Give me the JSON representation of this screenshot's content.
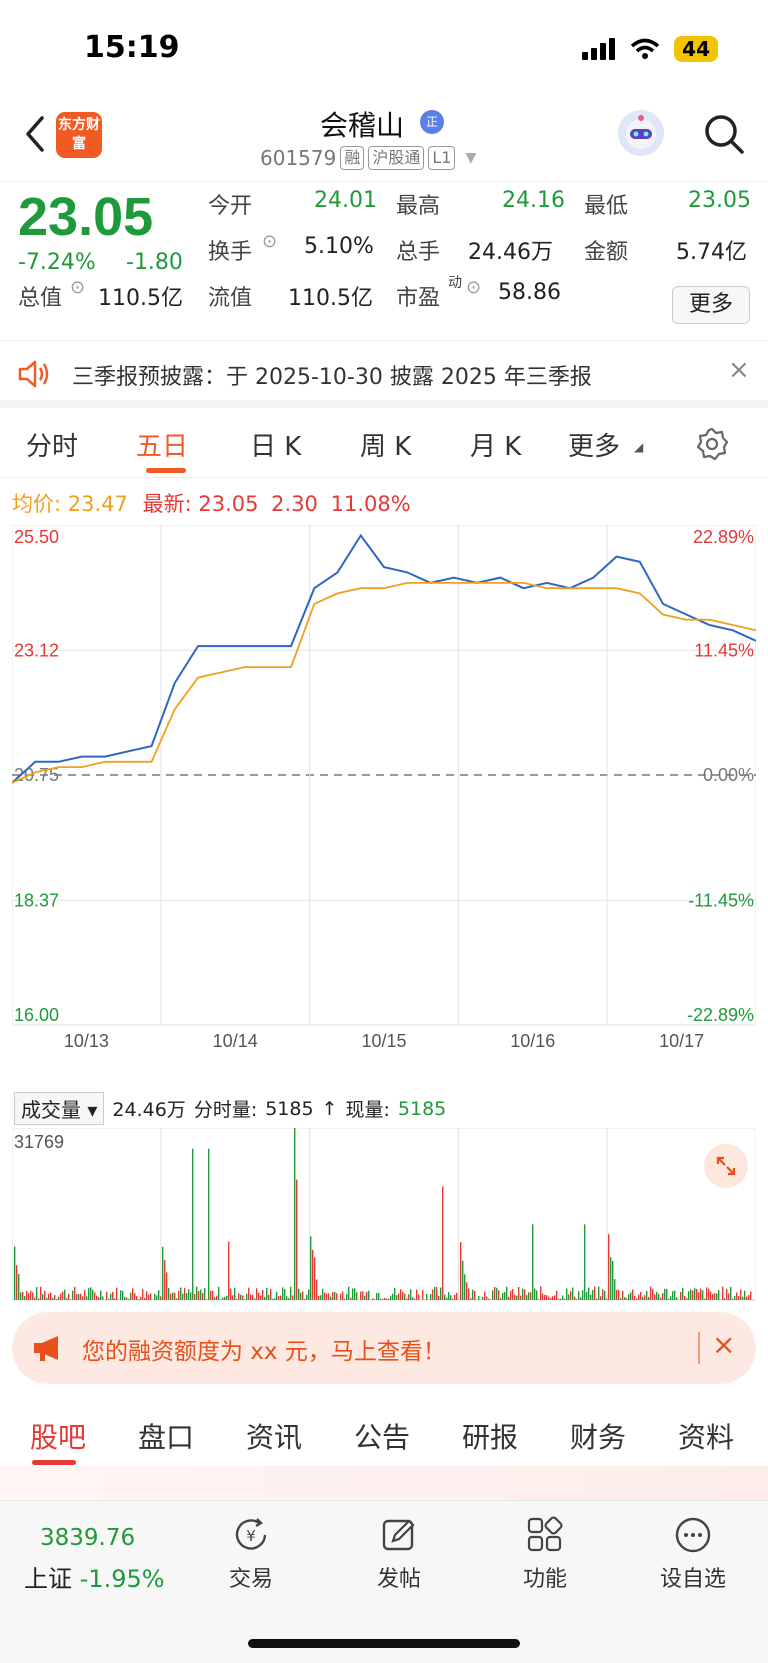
{
  "status_bar": {
    "time": "15:19",
    "battery": "44"
  },
  "header": {
    "app_logo_text": "东方财富",
    "stock_name": "会稽山",
    "badge": "正",
    "code": "601579",
    "tags": [
      "融",
      "沪股通",
      "L1"
    ]
  },
  "quote": {
    "price": "23.05",
    "change_pct": "-7.24%",
    "change": "-1.80",
    "fields": [
      {
        "label": "今开",
        "value": "24.01"
      },
      {
        "label": "最高",
        "value": "24.16"
      },
      {
        "label": "最低",
        "value": "23.05"
      },
      {
        "label": "换手",
        "value": "5.10%"
      },
      {
        "label": "总手",
        "value": "24.46万"
      },
      {
        "label": "金额",
        "value": "5.74亿"
      },
      {
        "label": "总值",
        "value": "110.5亿"
      },
      {
        "label": "流值",
        "value": "110.5亿"
      },
      {
        "label": "市盈",
        "sup": "动",
        "value": "58.86"
      }
    ],
    "more_label": "更多"
  },
  "notice": {
    "text": "三季报预披露：于 2025-10-30 披露 2025 年三季报",
    "close": "×"
  },
  "chart_tabs": {
    "items": [
      "分时",
      "五日",
      "日 K",
      "周 K",
      "月 K",
      "更多"
    ],
    "active": "五日"
  },
  "summary": {
    "avg_label": "均价:",
    "avg_value": "23.47",
    "latest_label": "最新:",
    "latest_value": "23.05",
    "latest_change": "2.30",
    "latest_pct": "11.08%"
  },
  "chart_data": {
    "type": "line",
    "x": [
      "10/13",
      "10/14",
      "10/15",
      "10/16",
      "10/17"
    ],
    "y_left_ticks": [
      "25.50",
      "23.12",
      "20.75",
      "18.37",
      "16.00"
    ],
    "y_right_ticks": [
      "22.89%",
      "11.45%",
      "0.00%",
      "-11.45%",
      "-22.89%"
    ],
    "ylim": [
      16.0,
      25.5
    ],
    "reference_price": 20.75,
    "series": [
      {
        "color": "#2f66c4",
        "values": [
          20.6,
          21.0,
          21.0,
          21.1,
          21.1,
          21.2,
          21.3,
          22.5,
          23.2,
          23.2,
          23.2,
          23.2,
          23.2,
          24.3,
          24.6,
          25.3,
          24.7,
          24.6,
          24.4,
          24.5,
          24.4,
          24.5,
          24.3,
          24.4,
          24.3,
          24.5,
          24.9,
          24.8,
          24.0,
          23.8,
          23.6,
          23.5,
          23.3
        ]
      },
      {
        "color": "#f0a020",
        "values": [
          20.6,
          20.8,
          20.9,
          20.9,
          21.0,
          21.0,
          21.0,
          22.0,
          22.6,
          22.7,
          22.8,
          22.8,
          22.8,
          24.0,
          24.2,
          24.3,
          24.3,
          24.4,
          24.4,
          24.4,
          24.4,
          24.4,
          24.4,
          24.3,
          24.3,
          24.3,
          24.3,
          24.2,
          23.8,
          23.7,
          23.7,
          23.6,
          23.5
        ]
      }
    ]
  },
  "volume": {
    "selector": "成交量",
    "total": "24.46万",
    "tick_label": "分时量:",
    "tick_value": "5185",
    "arrow": "↑",
    "current_label": "现量:",
    "current_value": "5185",
    "max_label": "31769"
  },
  "promo": {
    "text": "您的融资额度为 xx 元，马上查看！",
    "close": "×"
  },
  "section_tabs": {
    "items": [
      "股吧",
      "盘口",
      "资讯",
      "公告",
      "研报",
      "财务",
      "资料"
    ],
    "active": "股吧"
  },
  "bottom_nav": {
    "index_value": "3839.76",
    "index_name": "上证",
    "index_pct": "-1.95%",
    "items": [
      {
        "label": "交易",
        "icon": "trade-icon"
      },
      {
        "label": "发帖",
        "icon": "post-icon"
      },
      {
        "label": "功能",
        "icon": "grid-icon"
      },
      {
        "label": "设自选",
        "icon": "more-icon"
      }
    ]
  }
}
